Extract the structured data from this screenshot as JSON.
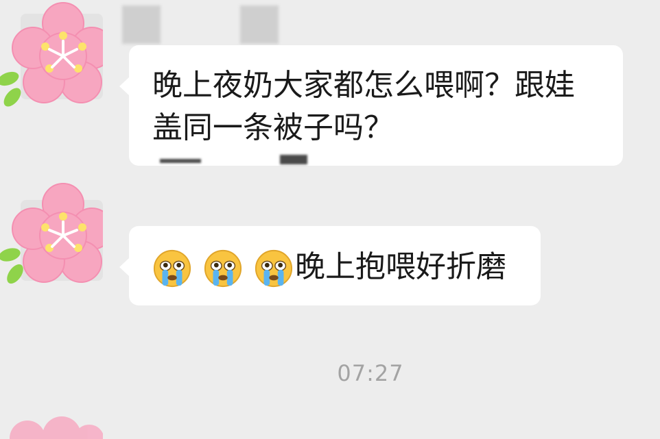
{
  "messages": [
    {
      "sender_avatar": "flower-avatar",
      "text": "晚上夜奶大家都怎么喂啊？跟娃盖同一条被子吗？"
    },
    {
      "sender_avatar": "flower-avatar",
      "emojis": [
        "crying-face-icon",
        "crying-face-icon",
        "crying-face-icon"
      ],
      "text": "晚上抱喂好折磨"
    }
  ],
  "timestamp": "07:27",
  "colors": {
    "background": "#ededed",
    "bubble": "#ffffff",
    "text": "#1a1a1a",
    "timestamp": "#a3a3a3",
    "flower_petal": "#f7a6c0",
    "flower_center": "#fde36b",
    "leaf": "#8fd34a"
  }
}
